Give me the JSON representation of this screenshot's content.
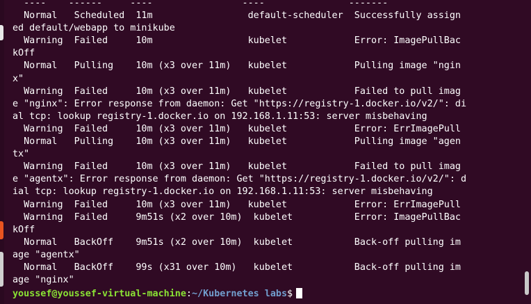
{
  "terminal": {
    "lines": [
      "  ----    ------     ----                ----               -------",
      "  Normal   Scheduled  11m                 default-scheduler  Successfully assign",
      "ed default/webapp to minikube",
      "  Warning  Failed     10m                 kubelet            Error: ImagePullBac",
      "kOff",
      "  Normal   Pulling    10m (x3 over 11m)   kubelet            Pulling image \"ngin",
      "x\"",
      "  Warning  Failed     10m (x3 over 11m)   kubelet            Failed to pull imag",
      "e \"nginx\": Error response from daemon: Get \"https://registry-1.docker.io/v2/\": di",
      "al tcp: lookup registry-1.docker.io on 192.168.1.11:53: server misbehaving",
      "  Warning  Failed     10m (x3 over 11m)   kubelet            Error: ErrImagePull",
      "  Normal   Pulling    10m (x3 over 11m)   kubelet            Pulling image \"agen",
      "tx\"",
      "  Warning  Failed     10m (x3 over 11m)   kubelet            Failed to pull imag",
      "e \"agentx\": Error response from daemon: Get \"https://registry-1.docker.io/v2/\": d",
      "ial tcp: lookup registry-1.docker.io on 192.168.1.11:53: server misbehaving",
      "  Warning  Failed     10m (x3 over 11m)   kubelet            Error: ErrImagePull",
      "  Warning  Failed     9m51s (x2 over 10m)  kubelet           Error: ImagePullBac",
      "kOff",
      "  Normal   BackOff    9m51s (x2 over 10m)  kubelet           Back-off pulling im",
      "age \"agentx\"",
      "  Normal   BackOff    99s (x31 over 10m)   kubelet           Back-off pulling im",
      "age \"nginx\""
    ],
    "prompt": {
      "user_host": "youssef@youssef-virtual-machine",
      "separator": ":",
      "path": "~/Kubernetes labs",
      "symbol": "$"
    }
  },
  "colors": {
    "background": "#300a24",
    "text": "#ffffff",
    "prompt_user": "#8ae234",
    "prompt_path": "#729fcf"
  }
}
